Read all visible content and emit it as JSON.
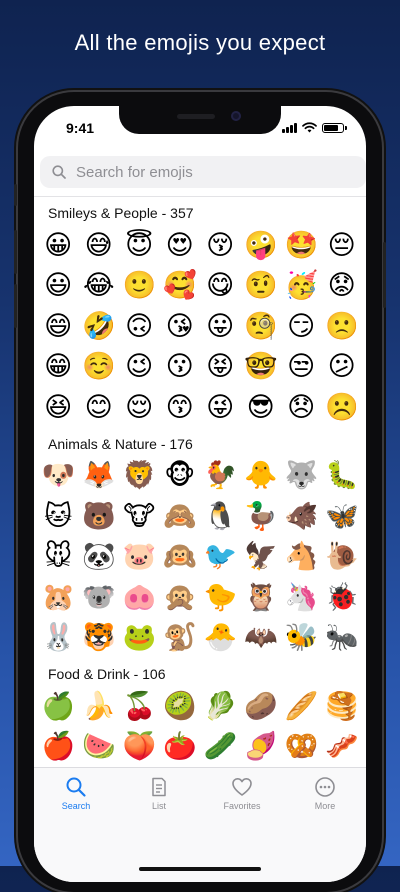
{
  "headline": "All the emojis you expect",
  "status_bar": {
    "time": "9:41",
    "battery_level": 0.85
  },
  "search": {
    "placeholder": "Search for emojis"
  },
  "sections": [
    {
      "title": "Smileys & People - 357",
      "rows": [
        [
          "😀",
          "😅",
          "😇",
          "😍",
          "😚",
          "🤪",
          "🤩",
          "😔",
          "😯"
        ],
        [
          "😃",
          "😂",
          "🙂",
          "🥰",
          "😋",
          "🤨",
          "🥳",
          "😟",
          "😵"
        ],
        [
          "😄",
          "🤣",
          "🙃",
          "😘",
          "😛",
          "🧐",
          "😏",
          "🙁",
          "😱"
        ],
        [
          "😁",
          "☺️",
          "😉",
          "😗",
          "😝",
          "🤓",
          "😒",
          "😕",
          "😨"
        ],
        [
          "😆",
          "😊",
          "😌",
          "😙",
          "😜",
          "😎",
          "😞",
          "☹️",
          "😰"
        ]
      ]
    },
    {
      "title": "Animals & Nature - 176",
      "rows": [
        [
          "🐶",
          "🦊",
          "🦁",
          "🐵",
          "🐓",
          "🐥",
          "🐺",
          "🐛",
          "🦟"
        ],
        [
          "🐱",
          "🐻",
          "🐮",
          "🙈",
          "🐧",
          "🦆",
          "🐗",
          "🦋",
          "🕷️"
        ],
        [
          "🐭",
          "🐼",
          "🐷",
          "🙉",
          "🐦",
          "🦅",
          "🐴",
          "🐌",
          "🦂"
        ],
        [
          "🐹",
          "🐨",
          "🐽",
          "🙊",
          "🐤",
          "🦉",
          "🦄",
          "🐞",
          "🐢"
        ],
        [
          "🐰",
          "🐯",
          "🐸",
          "🐒",
          "🐣",
          "🦇",
          "🐝",
          "🐜",
          "🐍"
        ]
      ]
    },
    {
      "title": "Food & Drink - 106",
      "rows": [
        [
          "🍏",
          "🍌",
          "🍒",
          "🥝",
          "🥬",
          "🥔",
          "🥖",
          "🥞",
          "🥢"
        ],
        [
          "🍎",
          "🍉",
          "🍑",
          "🍅",
          "🥒",
          "🍠",
          "🥨",
          "🥓",
          "🍗"
        ]
      ]
    }
  ],
  "tabs": [
    {
      "label": "Search",
      "icon": "magnifier",
      "active": true
    },
    {
      "label": "List",
      "icon": "list-doc",
      "active": false
    },
    {
      "label": "Favorites",
      "icon": "heart",
      "active": false
    },
    {
      "label": "More",
      "icon": "ellipsis-circle",
      "active": false
    }
  ],
  "colors": {
    "accent": "#1b7cf0",
    "inactive": "#8e8e93",
    "background_top": "#0f2350",
    "background_bottom": "#3465c2"
  }
}
